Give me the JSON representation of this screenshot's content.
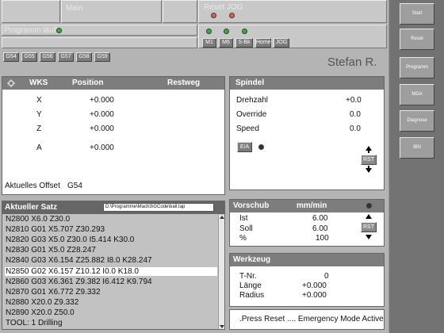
{
  "header": {
    "mode_label": "Main",
    "reset_label": "Reset",
    "jog_label": "JOG",
    "program_status": "Programm läuft",
    "mode_buttons": [
      "M1",
      "M6",
      "S-Bk",
      "Home",
      "JOG"
    ],
    "operator": "Stefan R."
  },
  "gcodes": [
    "G54",
    "G55",
    "G56",
    "G57",
    "G58",
    "G59"
  ],
  "wks": {
    "title": "WKS",
    "position_header": "Position",
    "restweg_header": "Restweg",
    "axes": [
      {
        "axis": "X",
        "position": "+0.000"
      },
      {
        "axis": "Y",
        "position": "+0.000"
      },
      {
        "axis": "Z",
        "position": "+0.000"
      },
      {
        "axis": "A",
        "position": "+0.000"
      }
    ],
    "offset_label": "Aktuelles Offset",
    "offset_value": "G54"
  },
  "spindel": {
    "title": "Spindel",
    "rows": [
      {
        "label": "Drehzahl",
        "value": "+0.0"
      },
      {
        "label": "Override",
        "value": "0.0"
      },
      {
        "label": "Speed",
        "value": "0.0"
      }
    ],
    "ea_label": "E/A",
    "rst_label": "RST"
  },
  "satz": {
    "title": "Aktueller Satz",
    "file_path": "D:\\Programme\\Mach3\\GCode\\ball.tap",
    "lines": [
      "N2800 X6.0 Z30.0",
      "N2810 G01 X5.707 Z30.293",
      "N2820 G03 X5.0 Z30.0 I5.414 K30.0",
      "N2830 G01 X5.0 Z28.247",
      "N2840 G03 X6.154 Z25.882 I8.0 K28.247",
      "N2850 G02 X6.157 Z10.12 I0.0 K18.0",
      "N2860 G03 X6.361 Z9.382 I6.412 K9.794",
      "N2870 G01 X6.772 Z9.332",
      "N2880 X20.0 Z9.332",
      "N2890 X20.0 Z50.0",
      "TOOL: 1 Drilling"
    ],
    "selected_index": 5
  },
  "vorschub": {
    "title": "Vorschub",
    "unit": "mm/min",
    "rows": [
      {
        "label": "Ist",
        "value": "6.00"
      },
      {
        "label": "Soll",
        "value": "6.00"
      },
      {
        "label": "%",
        "value": "100"
      }
    ],
    "rst_label": "RST"
  },
  "werkzeug": {
    "title": "Werkzeug",
    "rows": [
      {
        "label": "T-Nr.",
        "value": "0"
      },
      {
        "label": "Länge",
        "value": "+0.000"
      },
      {
        "label": "Radius",
        "value": "+0.000"
      }
    ]
  },
  "message": ".Press Reset .... Emergency Mode Active.",
  "sidebar": {
    "buttons": [
      "Start",
      "Reset",
      "Programm",
      "MDA",
      "Diagnose",
      "IBN"
    ]
  }
}
